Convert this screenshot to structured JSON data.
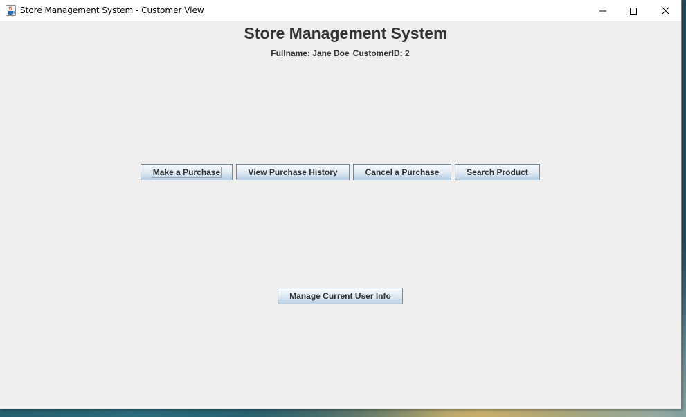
{
  "window": {
    "title": "Store Management System - Customer View",
    "icon": "java-cup-icon",
    "controls": [
      "minimize-icon",
      "maximize-icon",
      "close-icon"
    ]
  },
  "header": {
    "title": "Store Management System",
    "fullname": "Fullname: Jane Doe",
    "customer_id": "CustomerID: 2"
  },
  "actions": {
    "make_purchase": "Make a Purchase",
    "view_history": "View Purchase History",
    "cancel_purchase": "Cancel a Purchase",
    "search_product": "Search Product",
    "manage_user": "Manage Current User Info"
  },
  "colors": {
    "window_bg": "#eeeeee",
    "titlebar_bg": "#ffffff",
    "text": "#333333",
    "button_top": "#f7fafd",
    "button_bottom": "#b8cfe5",
    "button_border": "#7a8a99"
  }
}
